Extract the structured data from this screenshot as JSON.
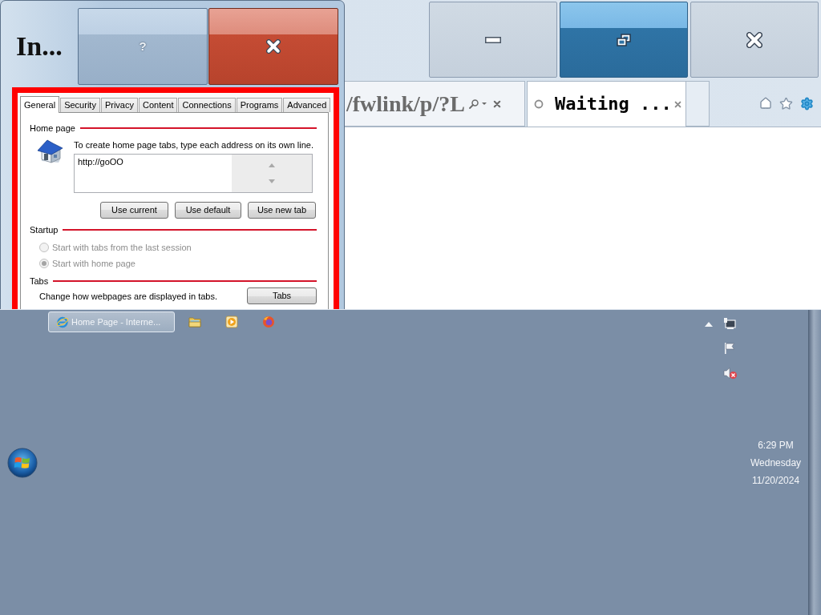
{
  "dialog": {
    "title": "In...",
    "help_button": "?",
    "tabs": [
      {
        "label": "General",
        "selected": true
      },
      {
        "label": "Security",
        "selected": false
      },
      {
        "label": "Privacy",
        "selected": false
      },
      {
        "label": "Content",
        "selected": false
      },
      {
        "label": "Connections",
        "selected": false
      },
      {
        "label": "Programs",
        "selected": false
      },
      {
        "label": "Advanced",
        "selected": false
      }
    ],
    "home_page": {
      "heading": "Home page",
      "instruction": "To create home page tabs, type each address on its own line.",
      "value": "http://goOO",
      "buttons": [
        "Use current",
        "Use default",
        "Use new tab"
      ]
    },
    "startup": {
      "heading": "Startup",
      "options": [
        {
          "label": "Start with tabs from the last session",
          "selected": false,
          "disabled": true
        },
        {
          "label": "Start with home page",
          "selected": true,
          "disabled": true
        }
      ]
    },
    "tabs_section": {
      "heading": "Tabs",
      "description": "Change how webpages are displayed in tabs.",
      "button": "Tabs"
    }
  },
  "browser": {
    "window_buttons": [
      {
        "kind": "minimize",
        "hovered": false
      },
      {
        "kind": "restore",
        "hovered": true
      },
      {
        "kind": "close",
        "hovered": false
      }
    ],
    "address": "/fwlink/p/?L",
    "tab": {
      "title": "Waiting ..."
    }
  },
  "taskbar": {
    "task": {
      "label": "Home Page - Interne..."
    },
    "clock": {
      "time": "6:29 PM",
      "day": "Wednesday",
      "date": "11/20/2024"
    }
  }
}
